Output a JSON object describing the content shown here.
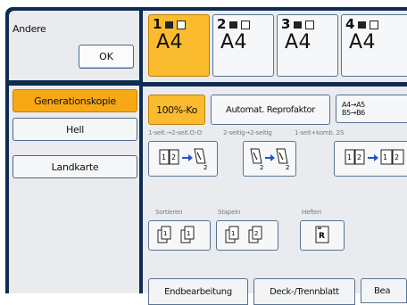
{
  "left_panel": {
    "title": "Andere",
    "ok_label": "OK",
    "functions": [
      "Generationskopie",
      "Hell",
      "Landkarte"
    ],
    "active_function": "Generationskopie"
  },
  "trays": [
    {
      "num": "1",
      "size": "A4"
    },
    {
      "num": "2",
      "size": "A4"
    },
    {
      "num": "3",
      "size": "A4"
    },
    {
      "num": "4",
      "size": "A4"
    }
  ],
  "reduce_enlarge": {
    "full_size": "100%-Ko",
    "auto_reduce_enlarge": "Automat. Reprofaktor",
    "ratio_line1": "A4→A5",
    "ratio_line2": "B5→B6"
  },
  "duplex": {
    "caption_1": "1-seit.→2-seit.O-O",
    "caption_2": "2-seitig→2-seitig",
    "caption_3": "1-seit+komb. 2S"
  },
  "finishing": {
    "sort": "Sortieren",
    "stack": "Stapeln",
    "staple": "Heften",
    "staple_icon_letter": "R"
  },
  "bottom_tabs": [
    "Endbearbeitung",
    "Deck-/Trennblatt",
    "Bea"
  ]
}
